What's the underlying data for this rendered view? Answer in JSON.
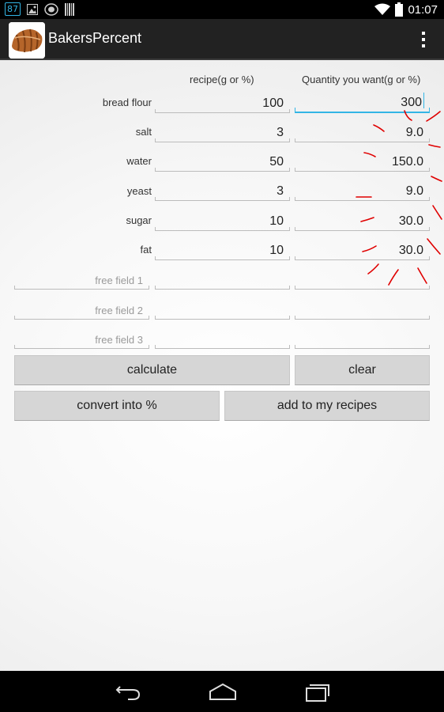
{
  "status_bar": {
    "notification_count": "87",
    "time": "01:07"
  },
  "action_bar": {
    "title": "BakersPercent",
    "app_icon": "croissant-icon",
    "menu_icon": "overflow-menu-icon"
  },
  "headers": {
    "recipe": "recipe(g or %)",
    "quantity": "Quantity you want(g or %)"
  },
  "rows": [
    {
      "label": "bread flour",
      "recipe": "100",
      "quantity": "300"
    },
    {
      "label": "salt",
      "recipe": "3",
      "quantity": "9.0"
    },
    {
      "label": "water",
      "recipe": "50",
      "quantity": "150.0"
    },
    {
      "label": "yeast",
      "recipe": "3",
      "quantity": "9.0"
    },
    {
      "label": "sugar",
      "recipe": "10",
      "quantity": "30.0"
    },
    {
      "label": "fat",
      "recipe": "10",
      "quantity": "30.0"
    }
  ],
  "free_fields": [
    {
      "hint": "free field 1"
    },
    {
      "hint": "free field 2"
    },
    {
      "hint": "free field 3"
    }
  ],
  "buttons": {
    "calculate": "calculate",
    "clear": "clear",
    "convert": "convert into %",
    "add": "add to my recipes"
  },
  "colors": {
    "accent": "#33b5e5",
    "annotation": "#e00000",
    "action_bar": "#222222",
    "button": "#d6d6d6"
  }
}
